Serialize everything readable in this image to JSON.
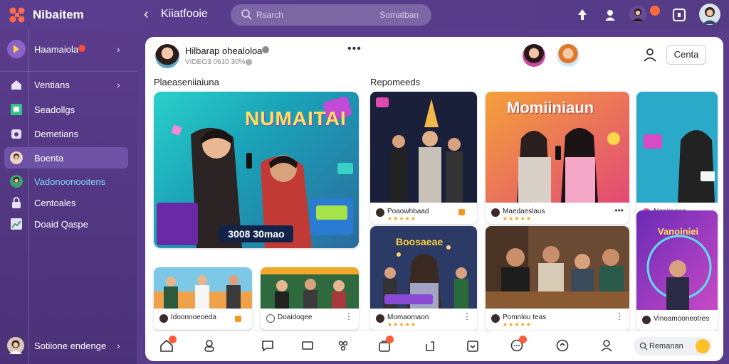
{
  "app": {
    "title": "Nibaitem"
  },
  "topbar": {
    "back_glyph": "‹",
    "crumb": "Kiiatfooie",
    "search_placeholder": "Rsarch",
    "search_right": "Somatban",
    "icons": [
      "upload-icon",
      "bell-icon",
      "avatar",
      "notification-badge",
      "window-icon",
      "profile-avatar"
    ]
  },
  "sidebar": {
    "profile": {
      "label": "Haamaiola"
    },
    "items": [
      {
        "label": "Ventians",
        "icon": "home-icon"
      },
      {
        "label": "Seadollgs",
        "icon": "calendar-icon"
      },
      {
        "label": "Demetians",
        "icon": "gear-icon"
      },
      {
        "label": "Boenta",
        "icon": "avatar",
        "active": true
      },
      {
        "label": "Vadonoonooitens",
        "icon": "avatar"
      },
      {
        "label": "Centoales",
        "icon": "lock-icon"
      },
      {
        "label": "Doaid Qaspe",
        "icon": "chart-icon"
      }
    ],
    "footer": {
      "label": "Sotiione endenge"
    }
  },
  "main": {
    "post": {
      "title": "Hilbarap ohealoloa",
      "sub": "VIDEO3 0610 30%",
      "dots": "•••"
    },
    "create_label": "Centa",
    "sections": {
      "left": "Plaeaseniiaiuna",
      "right": "Repomeeds"
    },
    "big_card": {
      "title": "NUMAITAI",
      "pill": "3008 30mao"
    },
    "cards": [
      {
        "title": "",
        "caption": "Poaowhbaad",
        "stars": "★★★★★"
      },
      {
        "title": "Momiiniaun",
        "caption": "Maedaeslaus",
        "stars": "★★★★★"
      },
      {
        "title": "",
        "caption": "Noaimena",
        "stars": ""
      },
      {
        "title": "Boosaeae",
        "caption": "Momaomaon",
        "stars": "★★★★★"
      },
      {
        "title": "",
        "caption": "Pomnlou teas",
        "stars": "★★★★★"
      },
      {
        "title": "Vanoiniei",
        "caption": "Vinoamooneotres",
        "stars": ""
      }
    ],
    "small_cards": [
      {
        "caption": "Idoonnoeoeda"
      },
      {
        "caption": "Doaidoqee"
      }
    ]
  },
  "bottomnav": {
    "search_text": "Remanan",
    "icons": [
      "home-icon",
      "user-icon",
      "chat-icon",
      "tablet-icon",
      "people-icon",
      "shop-icon",
      "share-icon",
      "download-icon",
      "message-icon",
      "refresh-icon",
      "user-icon"
    ]
  },
  "colors": {
    "sidebar": "#5a3c8c",
    "accent": "#6e52a6",
    "badge": "#ff5a3a",
    "stars": "#f2a31b"
  }
}
